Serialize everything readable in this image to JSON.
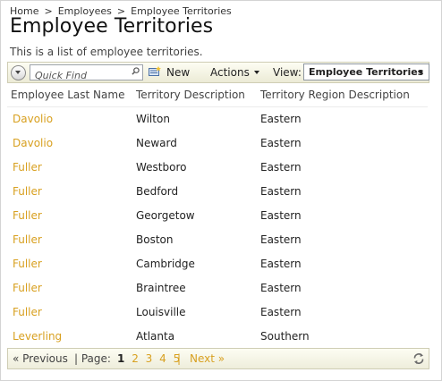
{
  "breadcrumb": {
    "home": "Home",
    "sep": ">",
    "employees": "Employees",
    "current": "Employee Territories"
  },
  "page_title": "Employee Territories",
  "description": "This is a list of employee territories.",
  "toolbar": {
    "quick_find_placeholder": "Quick Find",
    "new_label": "New",
    "actions_label": "Actions",
    "view_label": "View:",
    "view_value": "Employee Territories"
  },
  "table": {
    "columns": [
      "Employee Last Name",
      "Territory Description",
      "Territory Region Description"
    ],
    "rows": [
      {
        "last_name": "Davolio",
        "territory": "Wilton",
        "region": "Eastern"
      },
      {
        "last_name": "Davolio",
        "territory": "Neward",
        "region": "Eastern"
      },
      {
        "last_name": "Fuller",
        "territory": "Westboro",
        "region": "Eastern"
      },
      {
        "last_name": "Fuller",
        "territory": "Bedford",
        "region": "Eastern"
      },
      {
        "last_name": "Fuller",
        "territory": "Georgetow",
        "region": "Eastern"
      },
      {
        "last_name": "Fuller",
        "territory": "Boston",
        "region": "Eastern"
      },
      {
        "last_name": "Fuller",
        "territory": "Cambridge",
        "region": "Eastern"
      },
      {
        "last_name": "Fuller",
        "territory": "Braintree",
        "region": "Eastern"
      },
      {
        "last_name": "Fuller",
        "territory": "Louisville",
        "region": "Eastern"
      },
      {
        "last_name": "Leverling",
        "territory": "Atlanta",
        "region": "Southern"
      }
    ]
  },
  "pager": {
    "previous_label": "« Previous",
    "page_label": "| Page:",
    "pages": [
      "1",
      "2",
      "3",
      "4",
      "5"
    ],
    "current_page": "1",
    "separator": "|",
    "next_label": "Next »"
  },
  "colors": {
    "link": "#d8a020",
    "toolbar_bg": "#ecebd6"
  },
  "icons": {
    "toggle": "chevron-down-icon",
    "search": "search-icon",
    "new": "new-record-icon",
    "refresh": "refresh-icon"
  }
}
